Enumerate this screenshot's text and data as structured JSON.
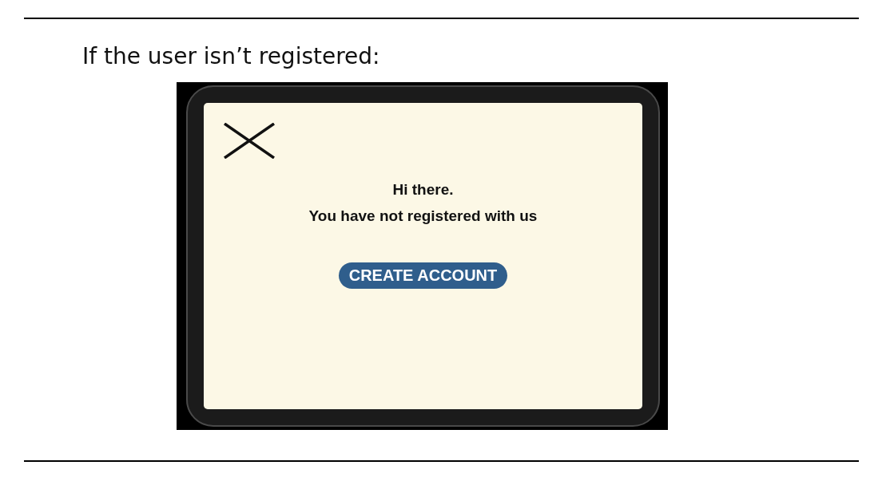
{
  "heading": "If the user isn’t registered:",
  "screen": {
    "greeting": "Hi there.",
    "message": "You have not registered with us",
    "button": "CREATE ACCOUNT"
  }
}
